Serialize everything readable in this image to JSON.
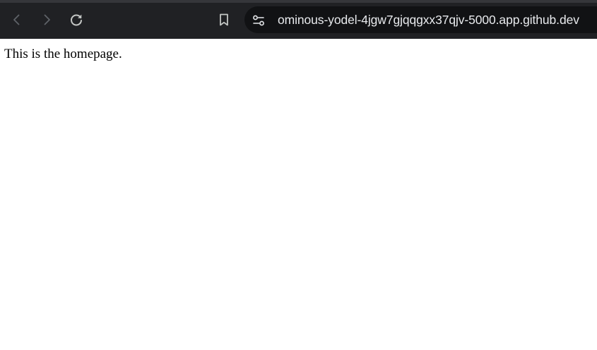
{
  "browser": {
    "address_bar": {
      "url": "ominous-yodel-4jgw7gjqqgxx37qjv-5000.app.github.dev"
    },
    "icons": {
      "back": "back-arrow-icon",
      "forward": "forward-arrow-icon",
      "reload": "reload-icon",
      "bookmark": "bookmark-icon",
      "site_info": "site-settings-icon"
    },
    "colors": {
      "toolbar_bg": "#202124",
      "omnibox_bg": "#111214",
      "icon_enabled": "#c4c7c5",
      "icon_disabled": "#5f6368",
      "url_text": "#e8eaed"
    }
  },
  "page": {
    "body_text": "This is the homepage."
  }
}
